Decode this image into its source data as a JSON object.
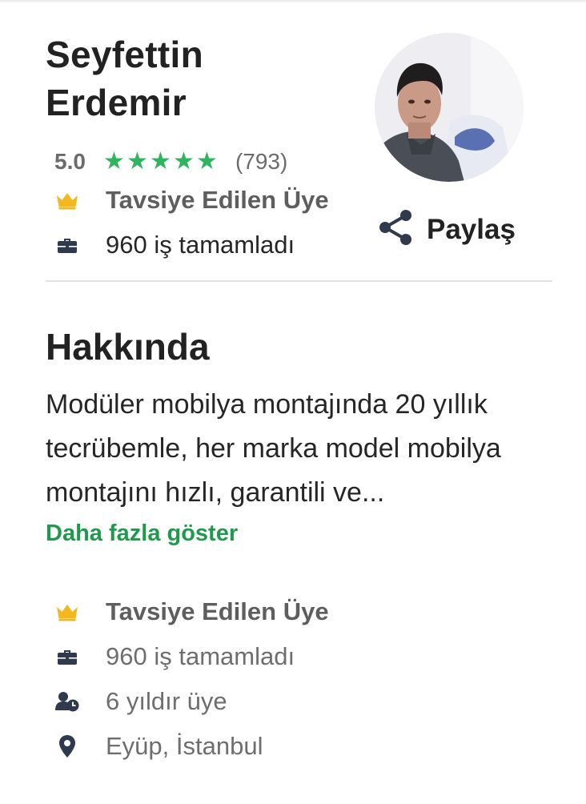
{
  "profile": {
    "name": "Seyfettin Erdemir",
    "rating": "5.0",
    "stars": [
      "★",
      "★",
      "★",
      "★",
      "★"
    ],
    "review_count": "(793)",
    "badge": "Tavsiye Edilen Üye",
    "jobs_completed": "960 iş tamamladı"
  },
  "share": {
    "label": "Paylaş"
  },
  "about": {
    "title": "Hakkında",
    "text": "Modüler mobilya montajında 20 yıllık tecrübemle, her marka model mobilya montajını hızlı, garantili ve...",
    "more_label": "Daha fazla göster"
  },
  "details": {
    "badge": "Tavsiye Edilen Üye",
    "jobs_completed": "960 iş tamamladı",
    "membership": "6 yıldır üye",
    "location": "Eyüp, İstanbul"
  },
  "colors": {
    "accent_green": "#2fb560",
    "link_green": "#1f9a4d",
    "crown_gold": "#f4b71d",
    "icon_dark": "#2f3a4e"
  },
  "icons": {
    "badge": "crown-icon",
    "jobs": "briefcase-icon",
    "member": "user-clock-icon",
    "location": "map-pin-icon",
    "share": "share-icon"
  }
}
